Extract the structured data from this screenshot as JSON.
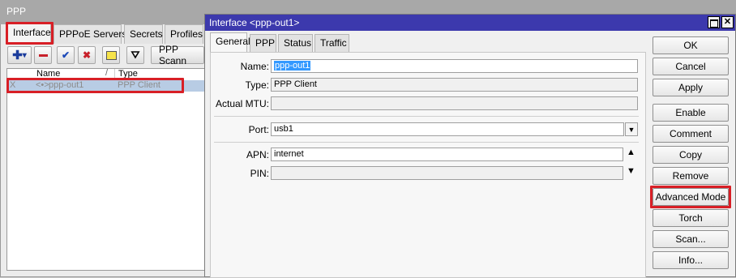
{
  "ppp": {
    "title": "PPP",
    "tabs": [
      "Interface",
      "PPPoE Servers",
      "Secrets",
      "Profiles"
    ],
    "toolbar": {
      "ppp_scanner_label": "PPP Scann"
    },
    "columns": {
      "name": "Name",
      "type": "Type"
    },
    "row": {
      "flag": "X",
      "icon": "<•>",
      "name": "ppp-out1",
      "type": "PPP Client"
    }
  },
  "dialog": {
    "title": "Interface <ppp-out1>",
    "tabs": [
      "General",
      "PPP",
      "Status",
      "Traffic"
    ],
    "fields": {
      "name_label": "Name:",
      "name_value": "ppp-out1",
      "type_label": "Type:",
      "type_value": "PPP Client",
      "mtu_label": "Actual MTU:",
      "mtu_value": "",
      "port_label": "Port:",
      "port_value": "usb1",
      "apn_label": "APN:",
      "apn_value": "internet",
      "pin_label": "PIN:",
      "pin_value": ""
    },
    "buttons": {
      "ok": "OK",
      "cancel": "Cancel",
      "apply": "Apply",
      "enable": "Enable",
      "comment": "Comment",
      "copy": "Copy",
      "remove": "Remove",
      "advanced_mode": "Advanced Mode",
      "torch": "Torch",
      "scan": "Scan...",
      "info": "Info..."
    }
  },
  "colors": {
    "dialog_title": "#3c39ad",
    "highlight": "#d81f26",
    "selected_row": "#b8cce4"
  }
}
